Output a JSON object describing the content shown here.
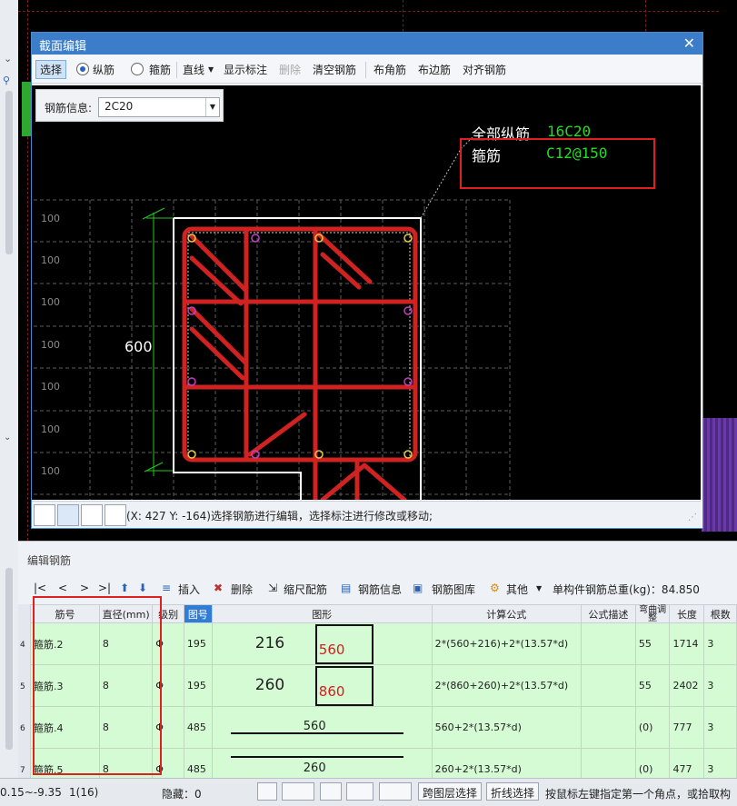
{
  "dialog": {
    "title": "截面编辑",
    "toolbar": {
      "select": "选择",
      "longitudinal": "纵筋",
      "stirrup": "箍筋",
      "line": "直线",
      "show_annotation": "显示标注",
      "delete": "删除",
      "clear": "清空钢筋",
      "corner": "布角筋",
      "edge": "布边筋",
      "align": "对齐钢筋"
    },
    "rebar_info_label": "钢筋信息:",
    "rebar_info_value": "2C20",
    "canvas": {
      "dim_600": "600",
      "grid_labels": [
        "100",
        "100",
        "100",
        "100",
        "100",
        "100",
        "100"
      ],
      "annotation_all_label": "全部纵筋",
      "annotation_all_value": "16C20",
      "annotation_stirrup_label": "箍筋",
      "annotation_stirrup_value": "C12@150"
    },
    "status_text": "(X: 427 Y: -164)选择钢筋进行编辑，选择标注进行修改或移动;"
  },
  "edit_panel": {
    "title": "编辑钢筋",
    "toolbar": {
      "insert": "插入",
      "delete": "删除",
      "scale": "缩尺配筋",
      "info": "钢筋信息",
      "library": "钢筋图库",
      "other": "其他",
      "total_weight": "单构件钢筋总重(kg)：84.850"
    },
    "headers": [
      "筋号",
      "直径(mm)",
      "级别",
      "图号",
      "图形",
      "计算公式",
      "公式描述",
      "弯曲调整",
      "长度",
      "根数"
    ],
    "rows": [
      {
        "num": "4",
        "name": "箍筋.2",
        "dia": "8",
        "grade": "Φ",
        "fig": "195",
        "shape_a": "216",
        "shape_b": "560",
        "formula": "2*(560+216)+2*(13.57*d)",
        "desc": "",
        "bend": "55",
        "len": "1714",
        "count": "3"
      },
      {
        "num": "5",
        "name": "箍筋.3",
        "dia": "8",
        "grade": "Φ",
        "fig": "195",
        "shape_a": "260",
        "shape_b": "860",
        "formula": "2*(860+260)+2*(13.57*d)",
        "desc": "",
        "bend": "55",
        "len": "2402",
        "count": "3"
      },
      {
        "num": "6",
        "name": "箍筋.4",
        "dia": "8",
        "grade": "Φ",
        "fig": "485",
        "shape_a": "560",
        "shape_b": "",
        "formula": "560+2*(13.57*d)",
        "desc": "",
        "bend": "(0)",
        "len": "777",
        "count": "3"
      },
      {
        "num": "7",
        "name": "箍筋.5",
        "dia": "8",
        "grade": "Φ",
        "fig": "485",
        "shape_a": "260",
        "shape_b": "",
        "formula": "260+2*(13.57*d)",
        "desc": "",
        "bend": "(0)",
        "len": "477",
        "count": "3"
      }
    ]
  },
  "statusbar": {
    "range": "0.15~-9.35",
    "floor": "1(16)",
    "hidden": "隐藏：0",
    "cross_layer": "跨图层选择",
    "polyline": "折线选择",
    "hint": "按鼠标左键指定第一个角点，或拾取构"
  }
}
